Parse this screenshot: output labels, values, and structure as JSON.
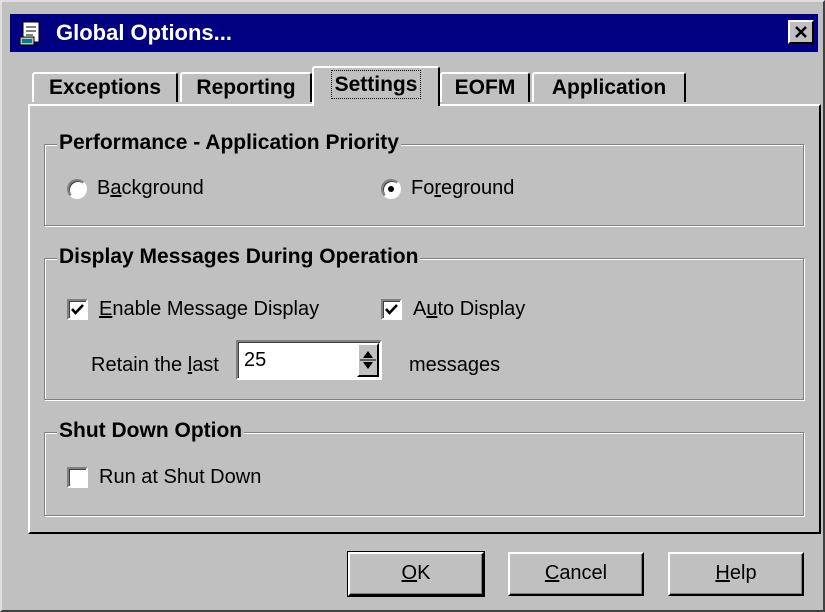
{
  "window": {
    "title": "Global Options..."
  },
  "tabs": [
    {
      "label": "Exceptions",
      "active": false
    },
    {
      "label": "Reporting",
      "active": false
    },
    {
      "label": "Settings",
      "active": true
    },
    {
      "label": "EOFM",
      "active": false
    },
    {
      "label": "Application",
      "active": false
    }
  ],
  "performance": {
    "title": "Performance - Application Priority",
    "background": {
      "pre": "B",
      "mn": "a",
      "post": "ckground",
      "selected": false
    },
    "foreground": {
      "pre": "Fo",
      "mn": "r",
      "post": "eground",
      "selected": true
    }
  },
  "display": {
    "title": "Display Messages During Operation",
    "enable": {
      "pre": "",
      "mn": "E",
      "post": "nable Message Display",
      "checked": true
    },
    "auto": {
      "pre": "A",
      "mn": "u",
      "post": "to Display",
      "checked": true
    },
    "retain_pre": "Retain the ",
    "retain_mn": "l",
    "retain_post": "ast",
    "retain_value": "25",
    "messages_label": "messages"
  },
  "shutdown": {
    "title": "Shut Down Option",
    "run": {
      "label": "Run at Shut Down",
      "checked": false
    }
  },
  "buttons": {
    "ok": {
      "mn": "O",
      "post": "K"
    },
    "cancel": {
      "mn": "C",
      "post": "ancel"
    },
    "help": {
      "mn": "H",
      "post": "elp"
    }
  }
}
